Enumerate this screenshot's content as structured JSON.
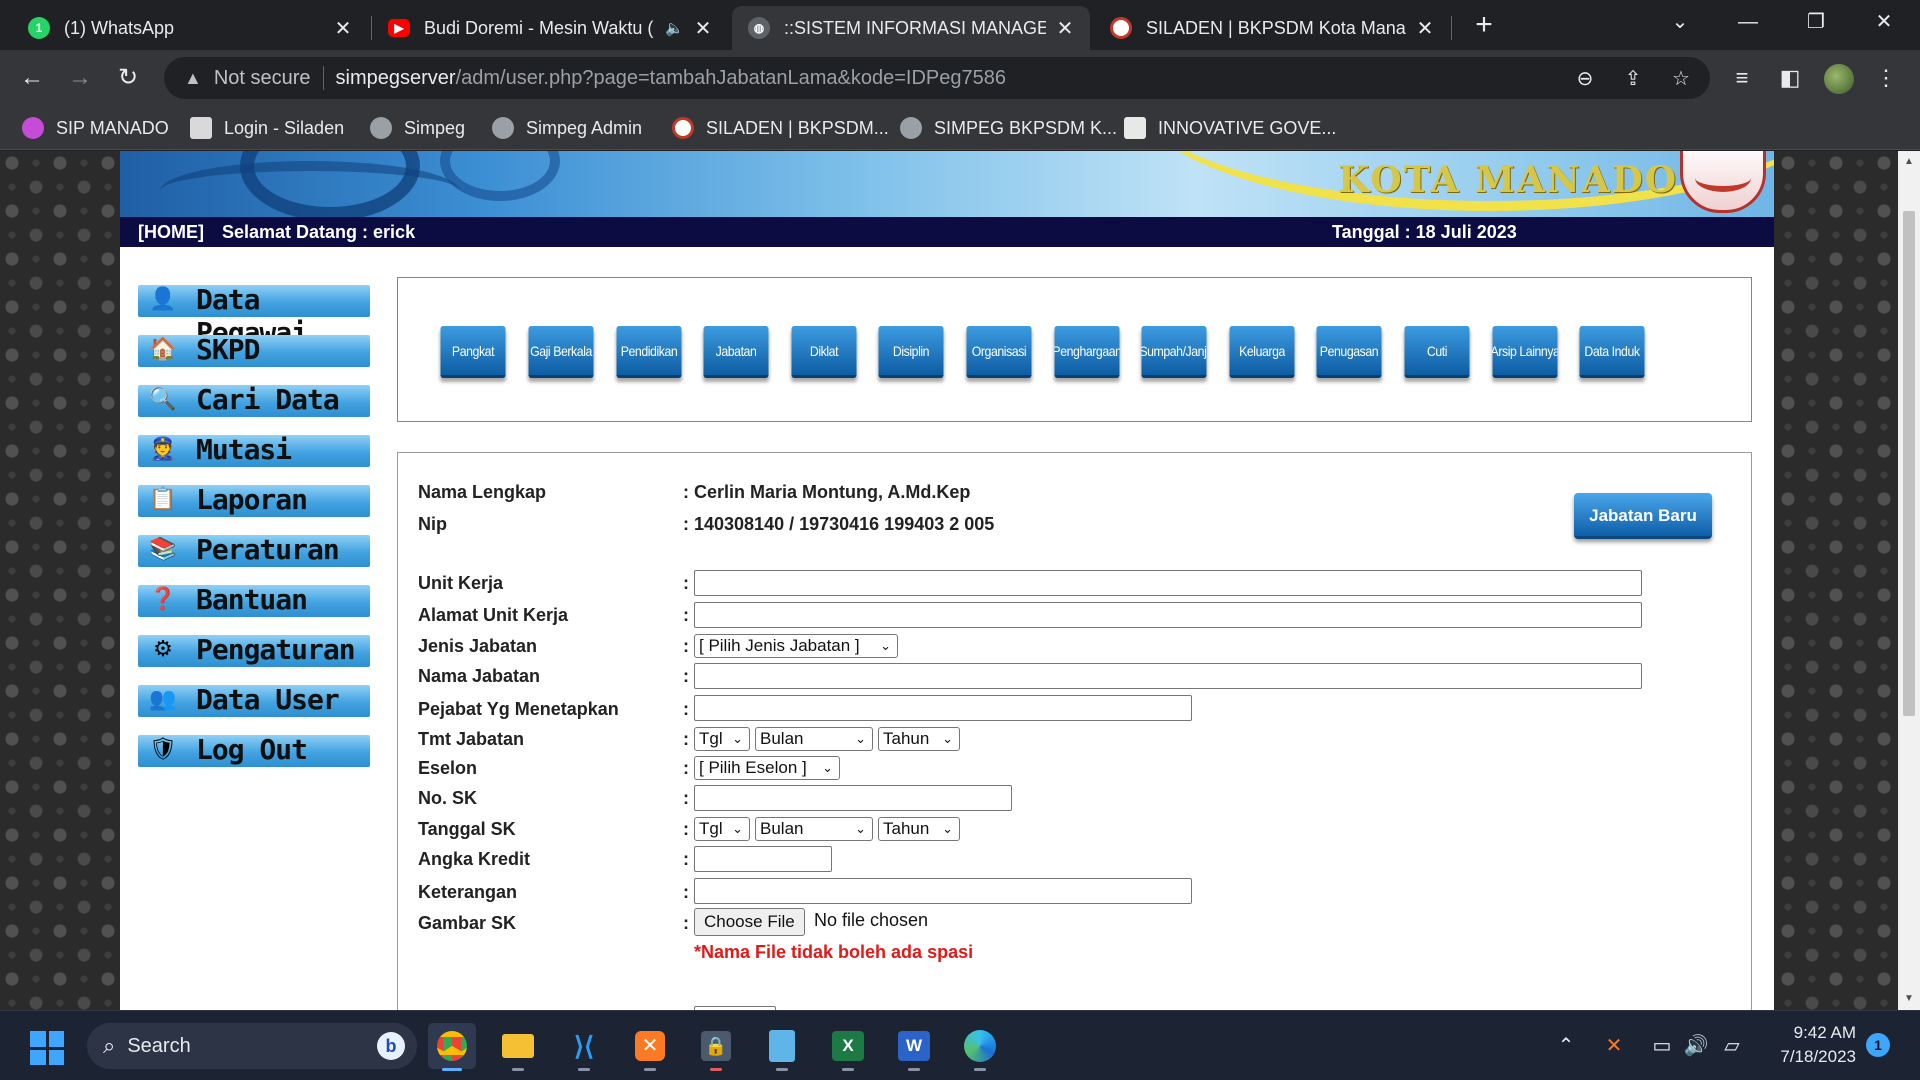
{
  "browser": {
    "tabs": [
      {
        "title": "(1) WhatsApp",
        "icon": "whatsapp-icon",
        "icon_color": "#25d366",
        "icon_text": "1"
      },
      {
        "title": "Budi Doremi - Mesin Waktu (",
        "icon": "youtube-icon",
        "icon_color": "#ff0000",
        "icon_text": "▶"
      },
      {
        "title": "::SISTEM INFORMASI MANAGEM",
        "icon": "globe-icon",
        "icon_color": "#9aa0a6",
        "icon_text": ""
      },
      {
        "title": "SILADEN | BKPSDM Kota Manado",
        "icon": "siladen-icon",
        "icon_color": "#c0392b",
        "icon_text": ""
      }
    ],
    "address": {
      "security_label": "Not secure",
      "url_host": "simpegserver",
      "url_path": "/adm/user.php?page=tambahJabatanLama&kode=IDPeg7586"
    },
    "bookmarks": [
      {
        "label": "SIP MANADO",
        "icon_color": "#c64bd6"
      },
      {
        "label": "Login - Siladen",
        "icon_color": "#d9d9d9"
      },
      {
        "label": "Simpeg",
        "icon_color": "#9aa0a6"
      },
      {
        "label": "Simpeg Admin",
        "icon_color": "#9aa0a6"
      },
      {
        "label": "SILADEN | BKPSDM...",
        "icon_color": "#c0392b"
      },
      {
        "label": "SIMPEG BKPSDM K...",
        "icon_color": "#9aa0a6"
      },
      {
        "label": "INNOVATIVE GOVE...",
        "icon_color": "#e8e8e8"
      }
    ]
  },
  "site": {
    "banner_text": "KOTA MANADO",
    "nav": {
      "home": "[HOME]",
      "welcome": "Selamat Datang : erick",
      "date": "Tanggal : 18 Juli 2023"
    },
    "sidebar": [
      {
        "label": "Data Pegawai",
        "icon": "employee-icon"
      },
      {
        "label": "SKPD",
        "icon": "house-icon"
      },
      {
        "label": "Cari Data",
        "icon": "magnifier-icon"
      },
      {
        "label": "Mutasi",
        "icon": "officer-icon"
      },
      {
        "label": "Laporan",
        "icon": "clipboard-icon"
      },
      {
        "label": "Peraturan",
        "icon": "books-icon"
      },
      {
        "label": "Bantuan",
        "icon": "help-icon"
      },
      {
        "label": "Pengaturan",
        "icon": "gear-icon"
      },
      {
        "label": "Data User",
        "icon": "users-icon"
      },
      {
        "label": "Log Out",
        "icon": "shield-icon"
      }
    ],
    "menu_buttons": [
      "Pangkat",
      "Gaji Berkala",
      "Pendidikan",
      "Jabatan",
      "Diklat",
      "Disiplin",
      "Organisasi",
      "Penghargaan",
      "Sumpah/Janji",
      "Keluarga",
      "Penugasan",
      "Cuti",
      "Arsip Lainnya",
      "Data Induk"
    ]
  },
  "form": {
    "new_position_button": "Jabatan Baru",
    "nama_label": "Nama Lengkap",
    "nama_value": ": Cerlin Maria Montung, A.Md.Kep",
    "nip_label": "Nip",
    "nip_value": ": 140308140 / 19730416 199403 2 005",
    "unit_kerja": "Unit Kerja",
    "alamat_unit_kerja": "Alamat Unit Kerja",
    "jenis_jabatan": "Jenis Jabatan",
    "jenis_jabatan_select": "[ Pilih Jenis Jabatan ]",
    "nama_jabatan": "Nama Jabatan",
    "pejabat": "Pejabat Yg Menetapkan",
    "tmt_jabatan": "Tmt Jabatan",
    "eselon": "Eselon",
    "eselon_select": "[ Pilih Eselon ]",
    "no_sk": "No. SK",
    "tanggal_sk": "Tanggal SK",
    "angka_kredit": "Angka Kredit",
    "keterangan": "Keterangan",
    "gambar_sk": "Gambar SK",
    "date_selects": {
      "day": "Tgl",
      "month": "Bulan",
      "year": "Tahun"
    },
    "colon": ":",
    "choose_file": "Choose File",
    "no_file": "No file chosen",
    "file_note": "*Nama File tidak boleh ada spasi"
  },
  "taskbar": {
    "search_placeholder": "Search",
    "time": "9:42 AM",
    "date": "7/18/2023",
    "notification_count": "1"
  }
}
